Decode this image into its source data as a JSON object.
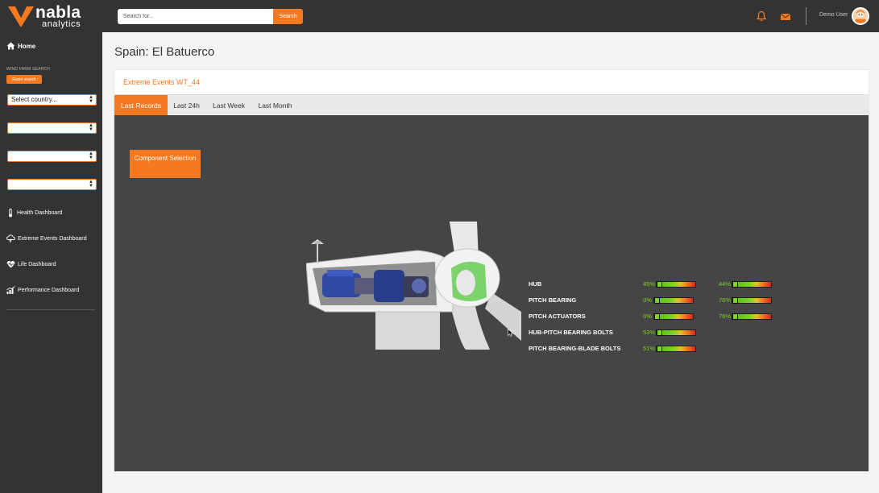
{
  "brand": {
    "name": "nabla",
    "sub": "analytics"
  },
  "header": {
    "search_placeholder": "Search for...",
    "search_button": "Search",
    "user_name": "Demo User"
  },
  "sidebar": {
    "home": "Home",
    "search_label": "WIND FARM SEARCH",
    "reset": "Reset search",
    "country_select": "Select country...",
    "selects": [
      "",
      "",
      ""
    ],
    "nav": [
      {
        "label": "Health Dashboard",
        "icon": "thermometer-icon"
      },
      {
        "label": "Extreme Events Dashboard",
        "icon": "cloud-lightning-icon"
      },
      {
        "label": "Life Dashboard",
        "icon": "heart-pulse-icon"
      },
      {
        "label": "Performance Dashboard",
        "icon": "bar-chart-icon"
      }
    ]
  },
  "page": {
    "title": "Spain: El Batuerco",
    "card_title": "Extreme Events WT_44",
    "tabs": [
      "Last Records",
      "Last 24h",
      "Last Week",
      "Last Month"
    ],
    "active_tab": "Last Records",
    "component_button": "Component Selection"
  },
  "components": [
    {
      "name": "HUB",
      "col1": "45%",
      "col1_level": 0.45,
      "col2": "44%",
      "col2_level": 0.44
    },
    {
      "name": "PITCH BEARING",
      "col1": "0%",
      "col1_level": 0,
      "col2": "76%",
      "col2_level": 0.76
    },
    {
      "name": "PITCH ACTUATORS",
      "col1": "0%",
      "col1_level": 0,
      "col2": "76%",
      "col2_level": 0.76
    },
    {
      "name": "HUB-PITCH BEARING BOLTS",
      "col1": "53%",
      "col1_level": 0.53
    },
    {
      "name": "PITCH BEARING-BLADE BOLTS",
      "col1": "51%",
      "col1_level": 0.51
    }
  ],
  "colors": {
    "accent": "#f47920",
    "dark": "#333333",
    "panel": "#454545",
    "ok": "#7dd321"
  }
}
